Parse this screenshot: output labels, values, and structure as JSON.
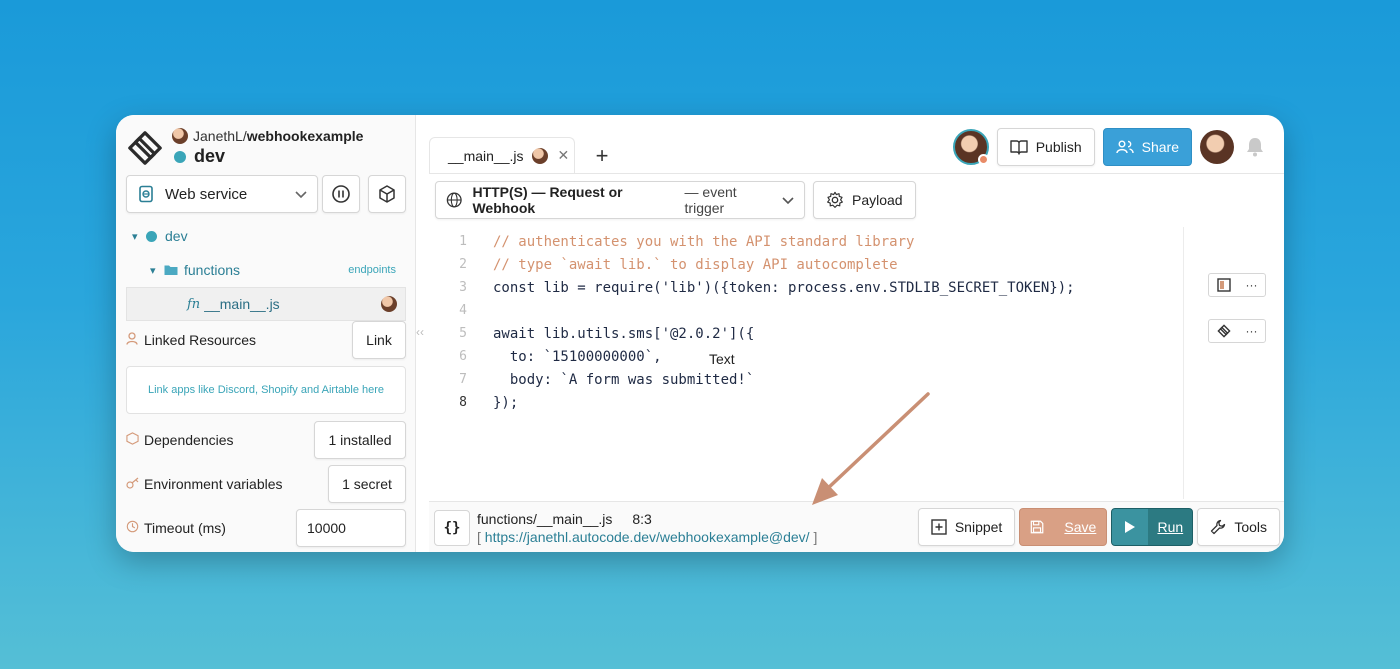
{
  "project": {
    "owner": "JanethL/",
    "name": "webhookexample",
    "environment": "dev"
  },
  "sidebar": {
    "service_type": "Web service",
    "tree": {
      "env": "dev",
      "folder": "functions",
      "folder_badge": "endpoints",
      "file_prefix": "fn",
      "file": "__main__.js"
    },
    "linked_resources": {
      "label": "Linked Resources",
      "button": "Link",
      "hint": "Link apps like Discord, Shopify and Airtable here"
    },
    "dependencies": {
      "label": "Dependencies",
      "button": "1 installed"
    },
    "env_vars": {
      "label": "Environment variables",
      "button": "1 secret"
    },
    "timeout": {
      "label": "Timeout (ms)",
      "value": "10000"
    }
  },
  "tabs": [
    {
      "label": "__main__.js"
    }
  ],
  "header": {
    "publish_label": "Publish",
    "share_label": "Share"
  },
  "trigger": {
    "type": "HTTP(S) — Request or Webhook",
    "subtype": "— event trigger",
    "payload_label": "Payload"
  },
  "editor": {
    "lines": [
      {
        "n": "1",
        "text": "// authenticates you with the API standard library",
        "kind": "comment"
      },
      {
        "n": "2",
        "text": "// type `await lib.` to display API autocomplete",
        "kind": "comment"
      },
      {
        "n": "3",
        "text": "const lib = require('lib')({token: process.env.STDLIB_SECRET_TOKEN});",
        "kind": "code"
      },
      {
        "n": "4",
        "text": "",
        "kind": "code"
      },
      {
        "n": "5",
        "text": "await lib.utils.sms['@2.0.2']({",
        "kind": "code"
      },
      {
        "n": "6",
        "text": "  to: `15100000000`,",
        "kind": "code"
      },
      {
        "n": "7",
        "text": "  body: `A form was submitted!`",
        "kind": "code"
      },
      {
        "n": "8",
        "text": "});",
        "kind": "code"
      }
    ],
    "active_line": "8",
    "tooltip": "Text"
  },
  "status": {
    "brace_label": "{}",
    "file_path": "functions/__main__.js",
    "cursor": "8:3",
    "url_open": "[",
    "url": "https://janethl.autocode.dev/webhookexample@dev/",
    "url_close": "]"
  },
  "actions": {
    "snippet_label": "Snippet",
    "save_label": "Save",
    "run_label": "Run",
    "tools_label": "Tools"
  },
  "colors": {
    "accent_teal": "#3aa5b8",
    "share_blue": "#3aa0d8",
    "save_orange": "#d9a085",
    "run_teal": "#2c7a82",
    "comment": "#d4926f",
    "arrow": "#c98f74"
  }
}
